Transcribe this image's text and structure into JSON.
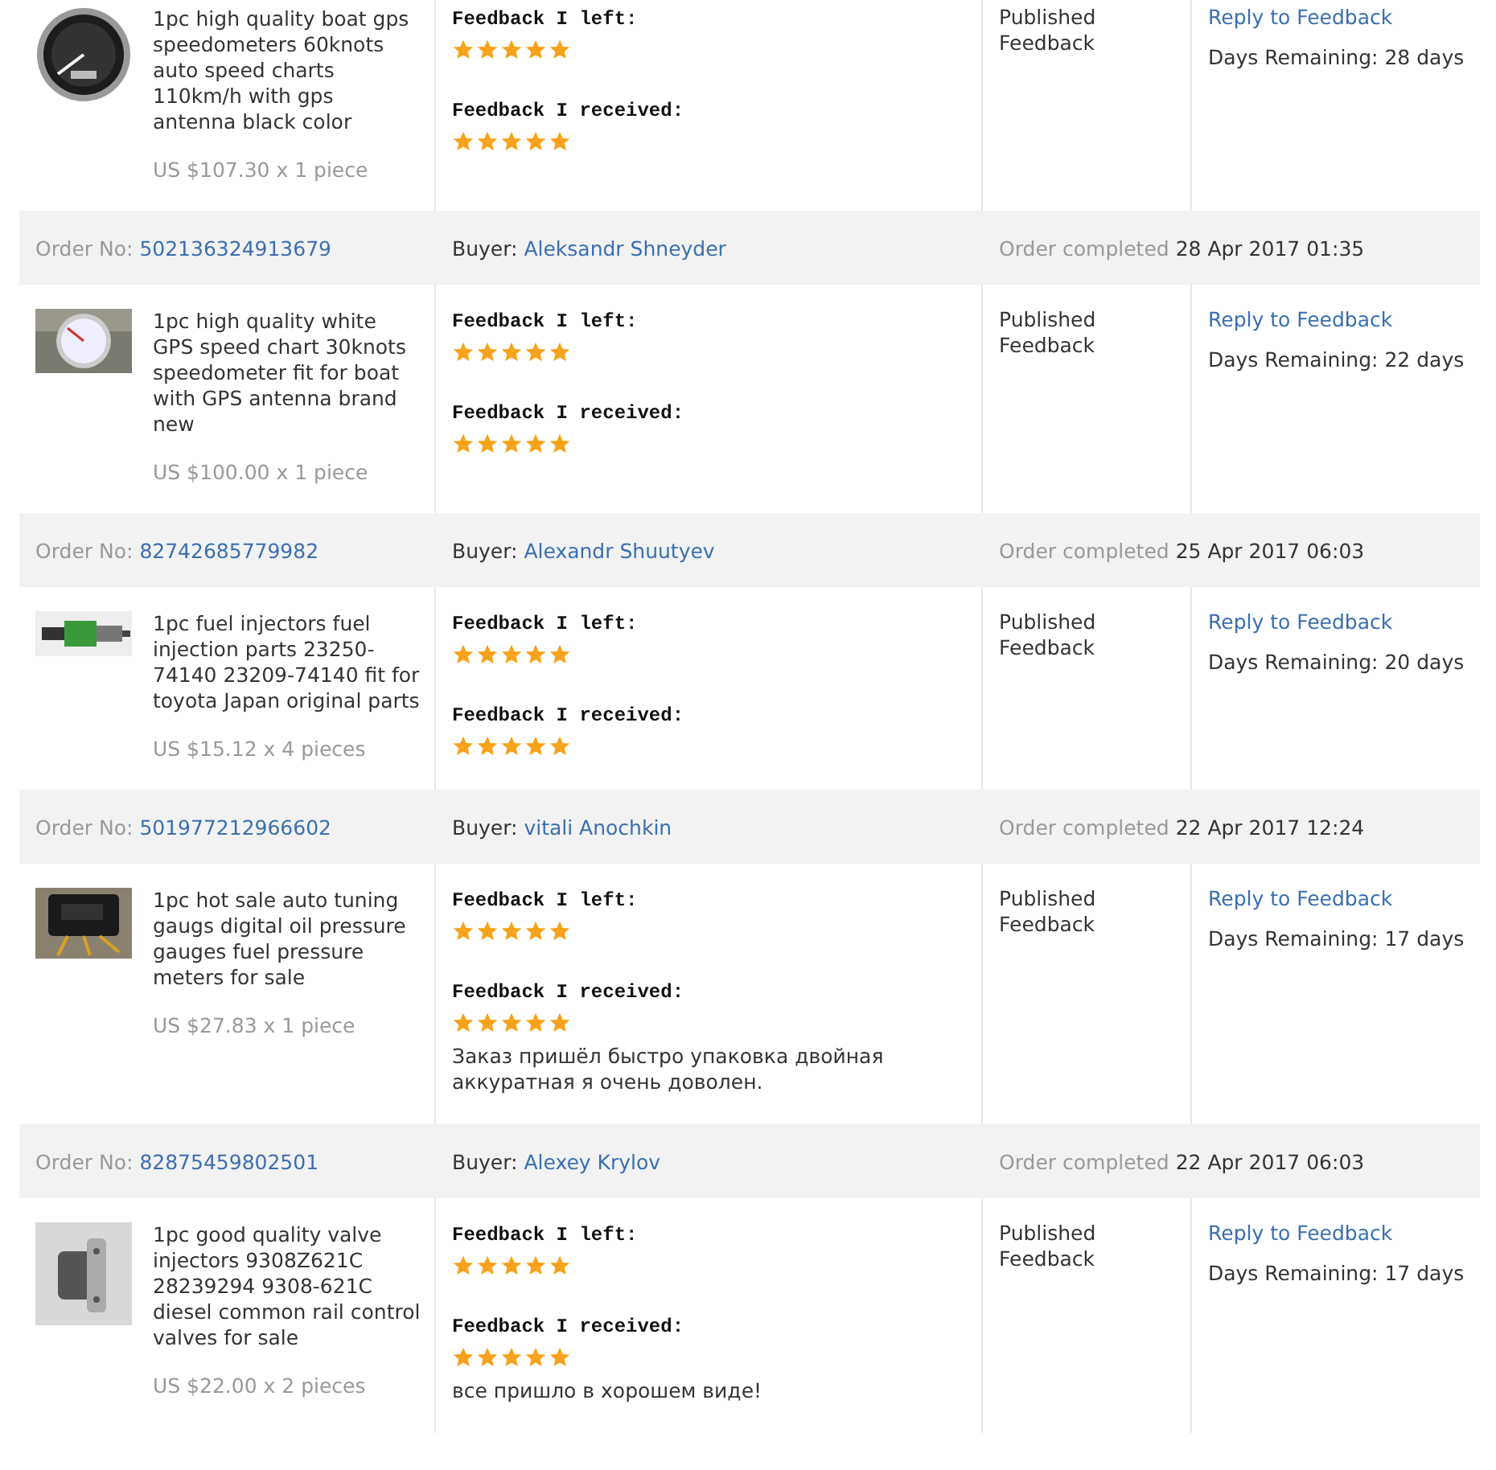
{
  "orders": [
    {
      "product": {
        "title": "1pc high quality boat gps speedometers 60knots auto speed charts 110km/h with gps antenna black color",
        "price": "US $107.30 x 1 piece"
      },
      "feedback_left": {
        "label": "Feedback I left:",
        "stars": 5
      },
      "feedback_received": {
        "label": "Feedback I received:",
        "stars": 5
      },
      "status": "Published Feedback",
      "action": "Reply to Feedback",
      "days_remaining": "Days Remaining: 28 days"
    },
    {
      "header": {
        "order_label": "Order No:",
        "order_no": "502136324913679",
        "buyer_label": "Buyer:",
        "buyer": "Aleksandr Shneyder",
        "completed_label": "Order completed",
        "completed_date": "28 Apr 2017 01:35"
      },
      "product": {
        "title": "1pc high quality white GPS speed chart 30knots speedometer fit for boat with GPS antenna brand new",
        "price": "US $100.00 x 1 piece"
      },
      "feedback_left": {
        "label": "Feedback I left:",
        "stars": 5
      },
      "feedback_received": {
        "label": "Feedback I received:",
        "stars": 5
      },
      "status": "Published Feedback",
      "action": "Reply to Feedback",
      "days_remaining": "Days Remaining: 22 days"
    },
    {
      "header": {
        "order_label": "Order No:",
        "order_no": "82742685779982",
        "buyer_label": "Buyer:",
        "buyer": "Alexandr Shuutyev",
        "completed_label": "Order completed",
        "completed_date": "25 Apr 2017 06:03"
      },
      "product": {
        "title": "1pc fuel injectors fuel injection parts 23250-74140 23209-74140 fit for toyota Japan original parts",
        "price": "US $15.12 x 4 pieces"
      },
      "feedback_left": {
        "label": "Feedback I left:",
        "stars": 5
      },
      "feedback_received": {
        "label": "Feedback I received:",
        "stars": 5
      },
      "status": "Published Feedback",
      "action": "Reply to Feedback",
      "days_remaining": "Days Remaining: 20 days"
    },
    {
      "header": {
        "order_label": "Order No:",
        "order_no": "501977212966602",
        "buyer_label": "Buyer:",
        "buyer": "vitali Anochkin",
        "completed_label": "Order completed",
        "completed_date": "22 Apr 2017 12:24"
      },
      "product": {
        "title": "1pc hot sale auto tuning gaugs digital oil pressure gauges fuel pressure meters for sale",
        "price": "US $27.83 x 1 piece"
      },
      "feedback_left": {
        "label": "Feedback I left:",
        "stars": 5
      },
      "feedback_received": {
        "label": "Feedback I received:",
        "stars": 5,
        "comment": "Заказ пришёл быстро упаковка двойная аккуратная я очень доволен."
      },
      "status": "Published Feedback",
      "action": "Reply to Feedback",
      "days_remaining": "Days Remaining: 17 days"
    },
    {
      "header": {
        "order_label": "Order No:",
        "order_no": "82875459802501",
        "buyer_label": "Buyer:",
        "buyer": "Alexey Krylov",
        "completed_label": "Order completed",
        "completed_date": "22 Apr 2017 06:03"
      },
      "product": {
        "title": "1pc good quality valve injectors 9308Z621C 28239294 9308-621C diesel common rail control valves for sale",
        "price": "US $22.00 x 2 pieces"
      },
      "feedback_left": {
        "label": "Feedback I left:",
        "stars": 5
      },
      "feedback_received": {
        "label": "Feedback I received:",
        "stars": 5,
        "comment": "все пришло в хорошем виде!"
      },
      "status": "Published Feedback",
      "action": "Reply to Feedback",
      "days_remaining": "Days Remaining: 17 days"
    }
  ]
}
